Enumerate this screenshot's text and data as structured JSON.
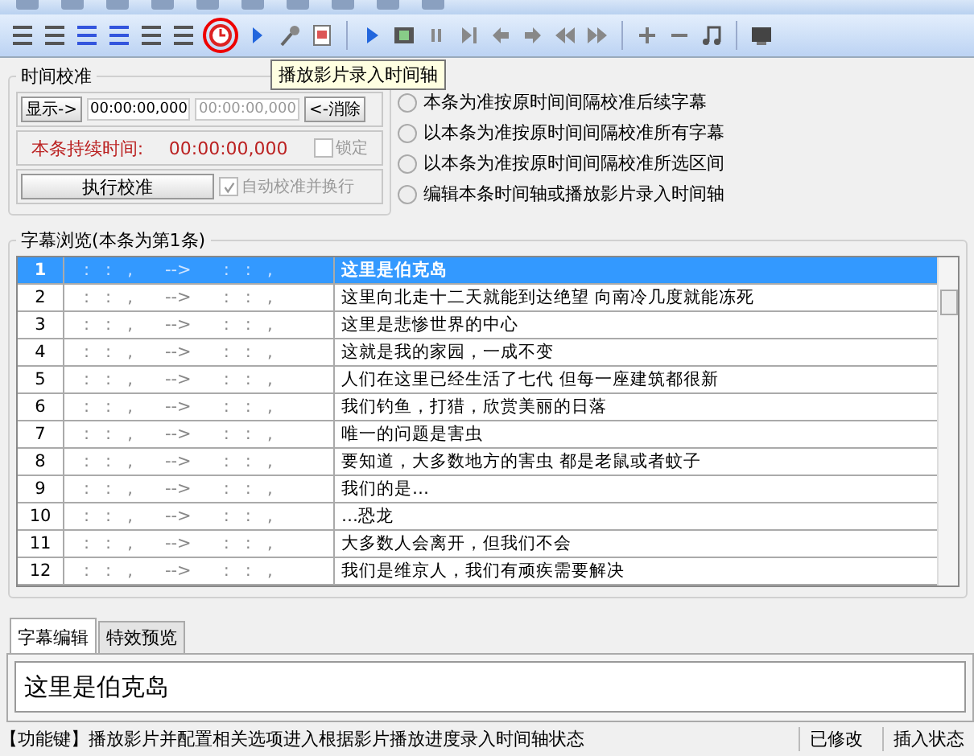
{
  "tooltip": "播放影片录入时间轴",
  "calibration": {
    "title": "时间校准",
    "display_button": "显示->",
    "start_time": "00:00:00,000",
    "end_time": "00:00:00,000",
    "clear_button": "<-消除",
    "duration_label": "本条持续时间:",
    "duration_value": "00:00:00,000",
    "lock": {
      "label": "锁定",
      "checked": false,
      "disabled": true
    },
    "run_button": "执行校准",
    "auto": {
      "label": "自动校准并换行",
      "checked": true,
      "disabled": true
    }
  },
  "modes": [
    {
      "label": "本条为准按原时间间隔校准后续字幕",
      "selected": false
    },
    {
      "label": "以本条为准按原时间间隔校准所有字幕",
      "selected": false
    },
    {
      "label": "以本条为准按原时间间隔校准所选区间",
      "selected": false
    },
    {
      "label": "编辑本条时间轴或播放影片录入时间轴",
      "selected": false
    }
  ],
  "browser": {
    "title": "字幕浏览(本条为第1条)",
    "rows": [
      {
        "index": "1",
        "timing": ":   :   ,      -->      :   :   ,",
        "text": "这里是伯克岛",
        "selected": true
      },
      {
        "index": "2",
        "timing": ":   :   ,      -->      :   :   ,",
        "text": "这里向北走十二天就能到达绝望 向南冷几度就能冻死",
        "selected": false
      },
      {
        "index": "3",
        "timing": ":   :   ,      -->      :   :   ,",
        "text": "这里是悲惨世界的中心",
        "selected": false
      },
      {
        "index": "4",
        "timing": ":   :   ,      -->      :   :   ,",
        "text": "这就是我的家园，一成不变",
        "selected": false
      },
      {
        "index": "5",
        "timing": ":   :   ,      -->      :   :   ,",
        "text": "人们在这里已经生活了七代 但每一座建筑都很新",
        "selected": false
      },
      {
        "index": "6",
        "timing": ":   :   ,      -->      :   :   ,",
        "text": "我们钓鱼，打猎，欣赏美丽的日落",
        "selected": false
      },
      {
        "index": "7",
        "timing": ":   :   ,      -->      :   :   ,",
        "text": "唯一的问题是害虫",
        "selected": false
      },
      {
        "index": "8",
        "timing": ":   :   ,      -->      :   :   ,",
        "text": "要知道，大多数地方的害虫 都是老鼠或者蚊子",
        "selected": false
      },
      {
        "index": "9",
        "timing": ":   :   ,      -->      :   :   ,",
        "text": "我们的是…",
        "selected": false
      },
      {
        "index": "10",
        "timing": ":   :   ,      -->      :   :   ,",
        "text": "…恐龙",
        "selected": false
      },
      {
        "index": "11",
        "timing": ":   :   ,      -->      :   :   ,",
        "text": "大多数人会离开，但我们不会",
        "selected": false
      },
      {
        "index": "12",
        "timing": ":   :   ,      -->      :   :   ,",
        "text": "我们是维京人，我们有顽疾需要解决",
        "selected": false
      }
    ]
  },
  "tabs": [
    {
      "label": "字幕编辑",
      "selected": true
    },
    {
      "label": "特效预览",
      "selected": false
    }
  ],
  "editor": {
    "value": "这里是伯克岛"
  },
  "status_bar": {
    "hint": "【功能键】播放影片并配置相关选项进入根据影片播放进度录入时间轴状态",
    "modified": "已修改",
    "mode": "插入状态"
  }
}
